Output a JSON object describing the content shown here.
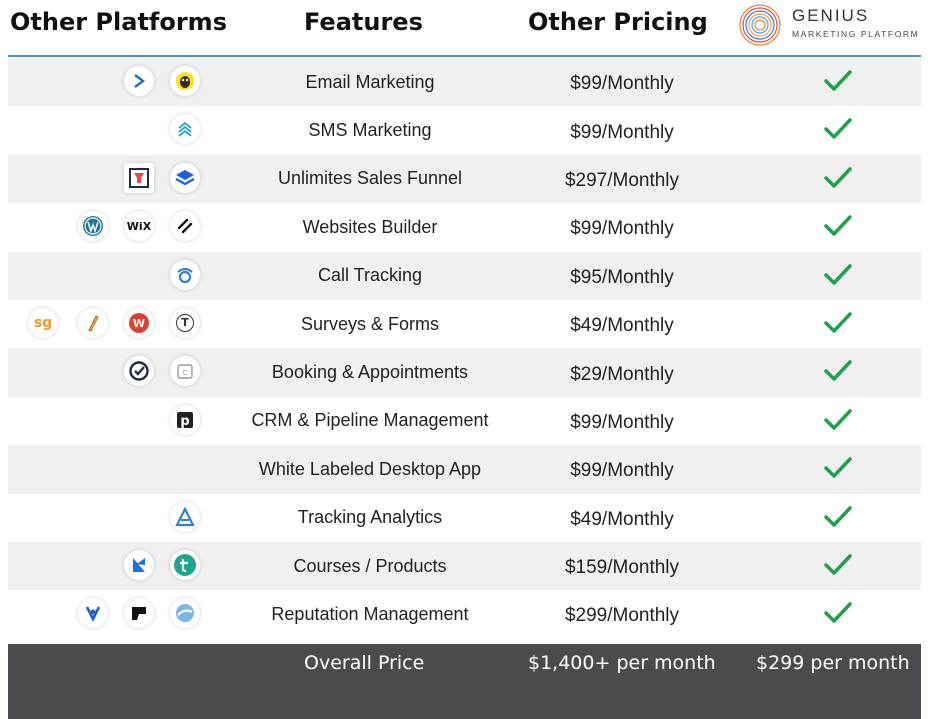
{
  "header": {
    "platforms": "Other Platforms",
    "features": "Features",
    "pricing": "Other Pricing",
    "logo_name": "GENIUS",
    "logo_tagline": "MARKETING PLATFORM"
  },
  "colors": {
    "accent_line": "#4a90c8",
    "check": "#1fa14a",
    "footer_bg": "#4a4b4e",
    "row_shade": "#f0f0f0"
  },
  "rows": [
    {
      "feature": "Email Marketing",
      "price": "$99/Monthly",
      "icons": [
        "sendinblue-icon",
        "mailchimp-icon"
      ]
    },
    {
      "feature": "SMS Marketing",
      "price": "$99/Monthly",
      "icons": [
        "sms-stack-icon"
      ]
    },
    {
      "feature": "Unlimites Sales Funnel",
      "price": "$297/Monthly",
      "icons": [
        "clickfunnels-icon",
        "leadpages-icon"
      ]
    },
    {
      "feature": "Websites Builder",
      "price": "$99/Monthly",
      "icons": [
        "wordpress-icon",
        "wix-icon",
        "squarespace-icon"
      ]
    },
    {
      "feature": "Call Tracking",
      "price": "$95/Monthly",
      "icons": [
        "call-tracking-icon"
      ]
    },
    {
      "feature": "Surveys & Forms",
      "price": "$49/Monthly",
      "icons": [
        "surveygizmo-icon",
        "survey-pen-icon",
        "wufoo-icon",
        "typeform-icon"
      ]
    },
    {
      "feature": "Booking & Appointments",
      "price": "$29/Monthly",
      "icons": [
        "acuity-icon",
        "calendly-icon"
      ]
    },
    {
      "feature": "CRM & Pipeline Management",
      "price": "$99/Monthly",
      "icons": [
        "pipedrive-icon"
      ]
    },
    {
      "feature": "White Labeled Desktop App",
      "price": "$99/Monthly",
      "icons": []
    },
    {
      "feature": "Tracking Analytics",
      "price": "$49/Monthly",
      "icons": [
        "analytics-icon"
      ]
    },
    {
      "feature": "Courses / Products",
      "price": "$159/Monthly",
      "icons": [
        "kajabi-icon",
        "teachable-icon"
      ]
    },
    {
      "feature": "Reputation Management",
      "price": "$299/Monthly",
      "icons": [
        "birdeye-icon",
        "podium-icon",
        "reputation-icon"
      ]
    }
  ],
  "footer": {
    "label": "Overall Price",
    "other_total": "$1,400+ per month",
    "genius_total": "$299 per month"
  },
  "icon_glyphs": {
    "wix": "WiX",
    "sg": "sg",
    "t": "T",
    "p": "p",
    "w": "W",
    "c": "C",
    "typeform": "T"
  }
}
